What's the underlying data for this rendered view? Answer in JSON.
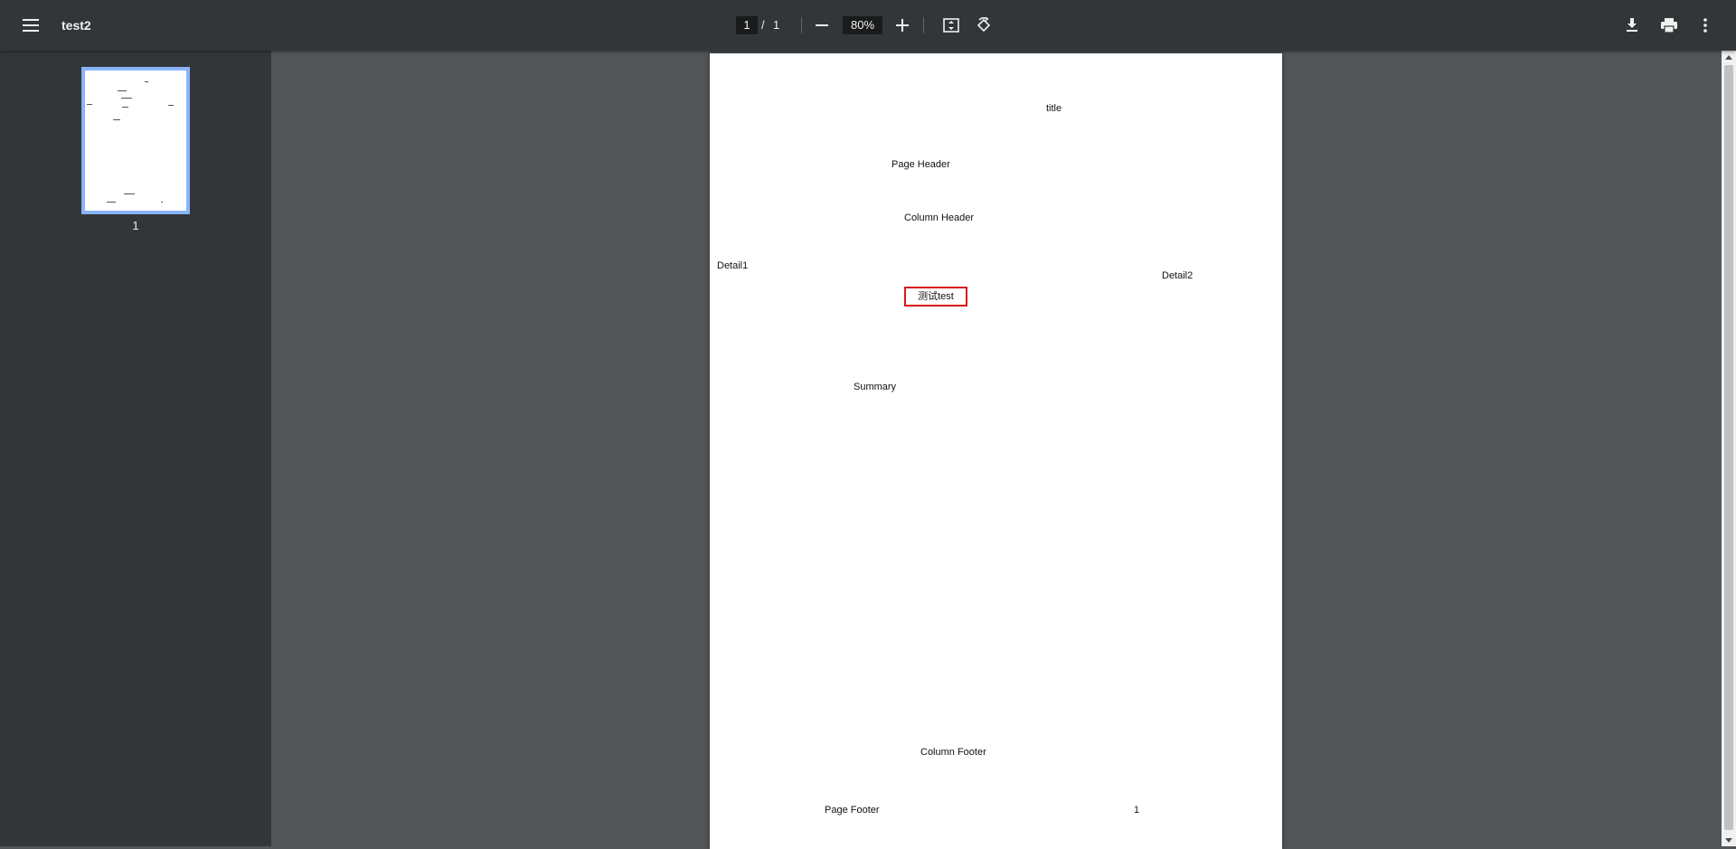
{
  "toolbar": {
    "menu_icon": "hamburger-menu-icon",
    "title": "test2",
    "current_page": "1",
    "page_separator": "/",
    "total_pages": "1",
    "zoom": "80%",
    "zoom_out_icon": "minus-icon",
    "zoom_in_icon": "plus-icon",
    "fit_icon": "fit-to-page-icon",
    "rotate_icon": "rotate-icon",
    "download_icon": "download-icon",
    "print_icon": "print-icon",
    "more_icon": "more-vert-icon"
  },
  "sidebar": {
    "thumbnails": [
      {
        "page_number": "1",
        "selected": true
      }
    ],
    "selected_color": "#8ab4f8"
  },
  "page": {
    "title": "title",
    "page_header": "Page Header",
    "column_header": "Column Header",
    "detail1": "Detail1",
    "detail2": "Detail2",
    "boxed_text": "测试test",
    "summary": "Summary",
    "column_footer": "Column Footer",
    "page_footer": "Page Footer",
    "page_number": "1",
    "box_border_color": "#d8161b"
  },
  "colors": {
    "toolbar_bg": "#323639",
    "viewer_bg": "#525659",
    "sidebar_bg": "#323639"
  }
}
